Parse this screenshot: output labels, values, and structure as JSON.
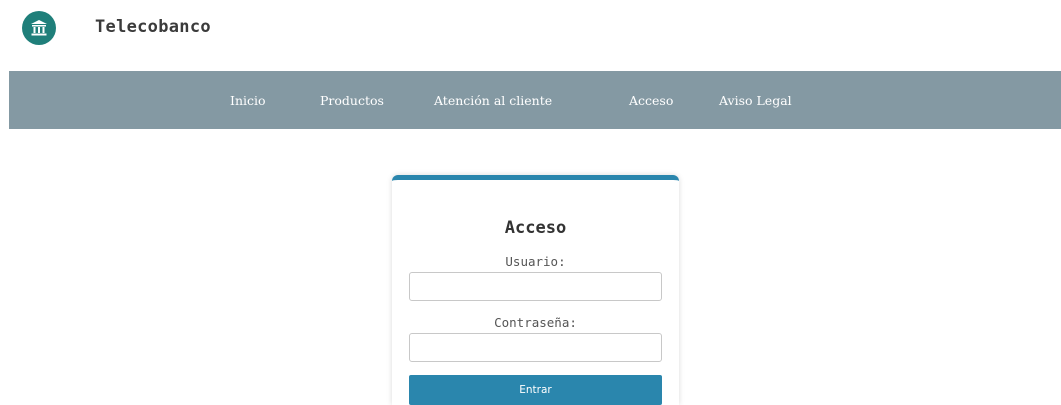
{
  "header": {
    "brand": "Telecobanco",
    "logo_icon": "bank-icon",
    "logo_color": "#1f7f7a"
  },
  "nav": {
    "background": "#8499a3",
    "items": [
      {
        "label": "Inicio"
      },
      {
        "label": "Productos"
      },
      {
        "label": "Atención al cliente"
      },
      {
        "label": "Acceso"
      },
      {
        "label": "Aviso Legal"
      }
    ]
  },
  "login": {
    "title": "Acceso",
    "accent": "#2a86ad",
    "username_label": "Usuario:",
    "username_value": "",
    "password_label": "Contraseña:",
    "password_value": "",
    "submit_label": "Entrar"
  }
}
